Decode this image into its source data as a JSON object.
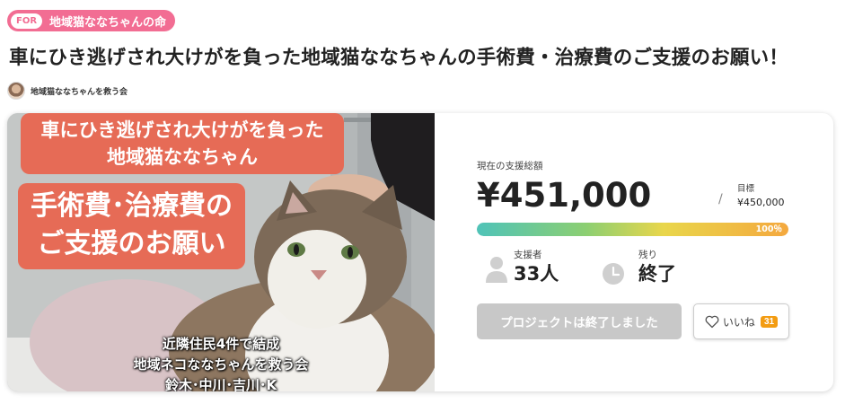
{
  "tag": {
    "prefix": "FOR",
    "label": "地域猫ななちゃんの命"
  },
  "title": "車にひき逃げされ大けがを負った地域猫ななちゃんの手術費・治療費のご支援のお願い！",
  "owner": {
    "name": "地域猫ななちゃんを救う会"
  },
  "hero": {
    "banner_line1": "車にひき逃げされ大けがを負った",
    "banner_line2": "地域猫ななちゃん",
    "banner_big1": "手術費･治療費の",
    "banner_big2": "ご支援のお願い",
    "foot_line1": "近隣住民4件で結成",
    "foot_line2": "地域ネコななちゃんを救う会",
    "foot_line3": "鈴木･中川･吉川･K"
  },
  "funding": {
    "current_label": "現在の支援総額",
    "amount": "¥451,000",
    "slash": "/",
    "target_label": "目標",
    "target_value": "¥450,000",
    "progress_text": "100％",
    "progress_fraction": 1.0,
    "colors": {
      "bar_start": "#4fc3b8",
      "bar_end": "#f4a83e"
    }
  },
  "stats": {
    "supporters_label": "支援者",
    "supporters_value": "33人",
    "remaining_label": "残り",
    "remaining_value": "終了",
    "supporters_icon": "person-icon",
    "remaining_icon": "clock-icon"
  },
  "actions": {
    "ended_label": "プロジェクトは終了しました",
    "like_label": "いいね",
    "like_count": "31",
    "like_icon": "heart-icon"
  }
}
